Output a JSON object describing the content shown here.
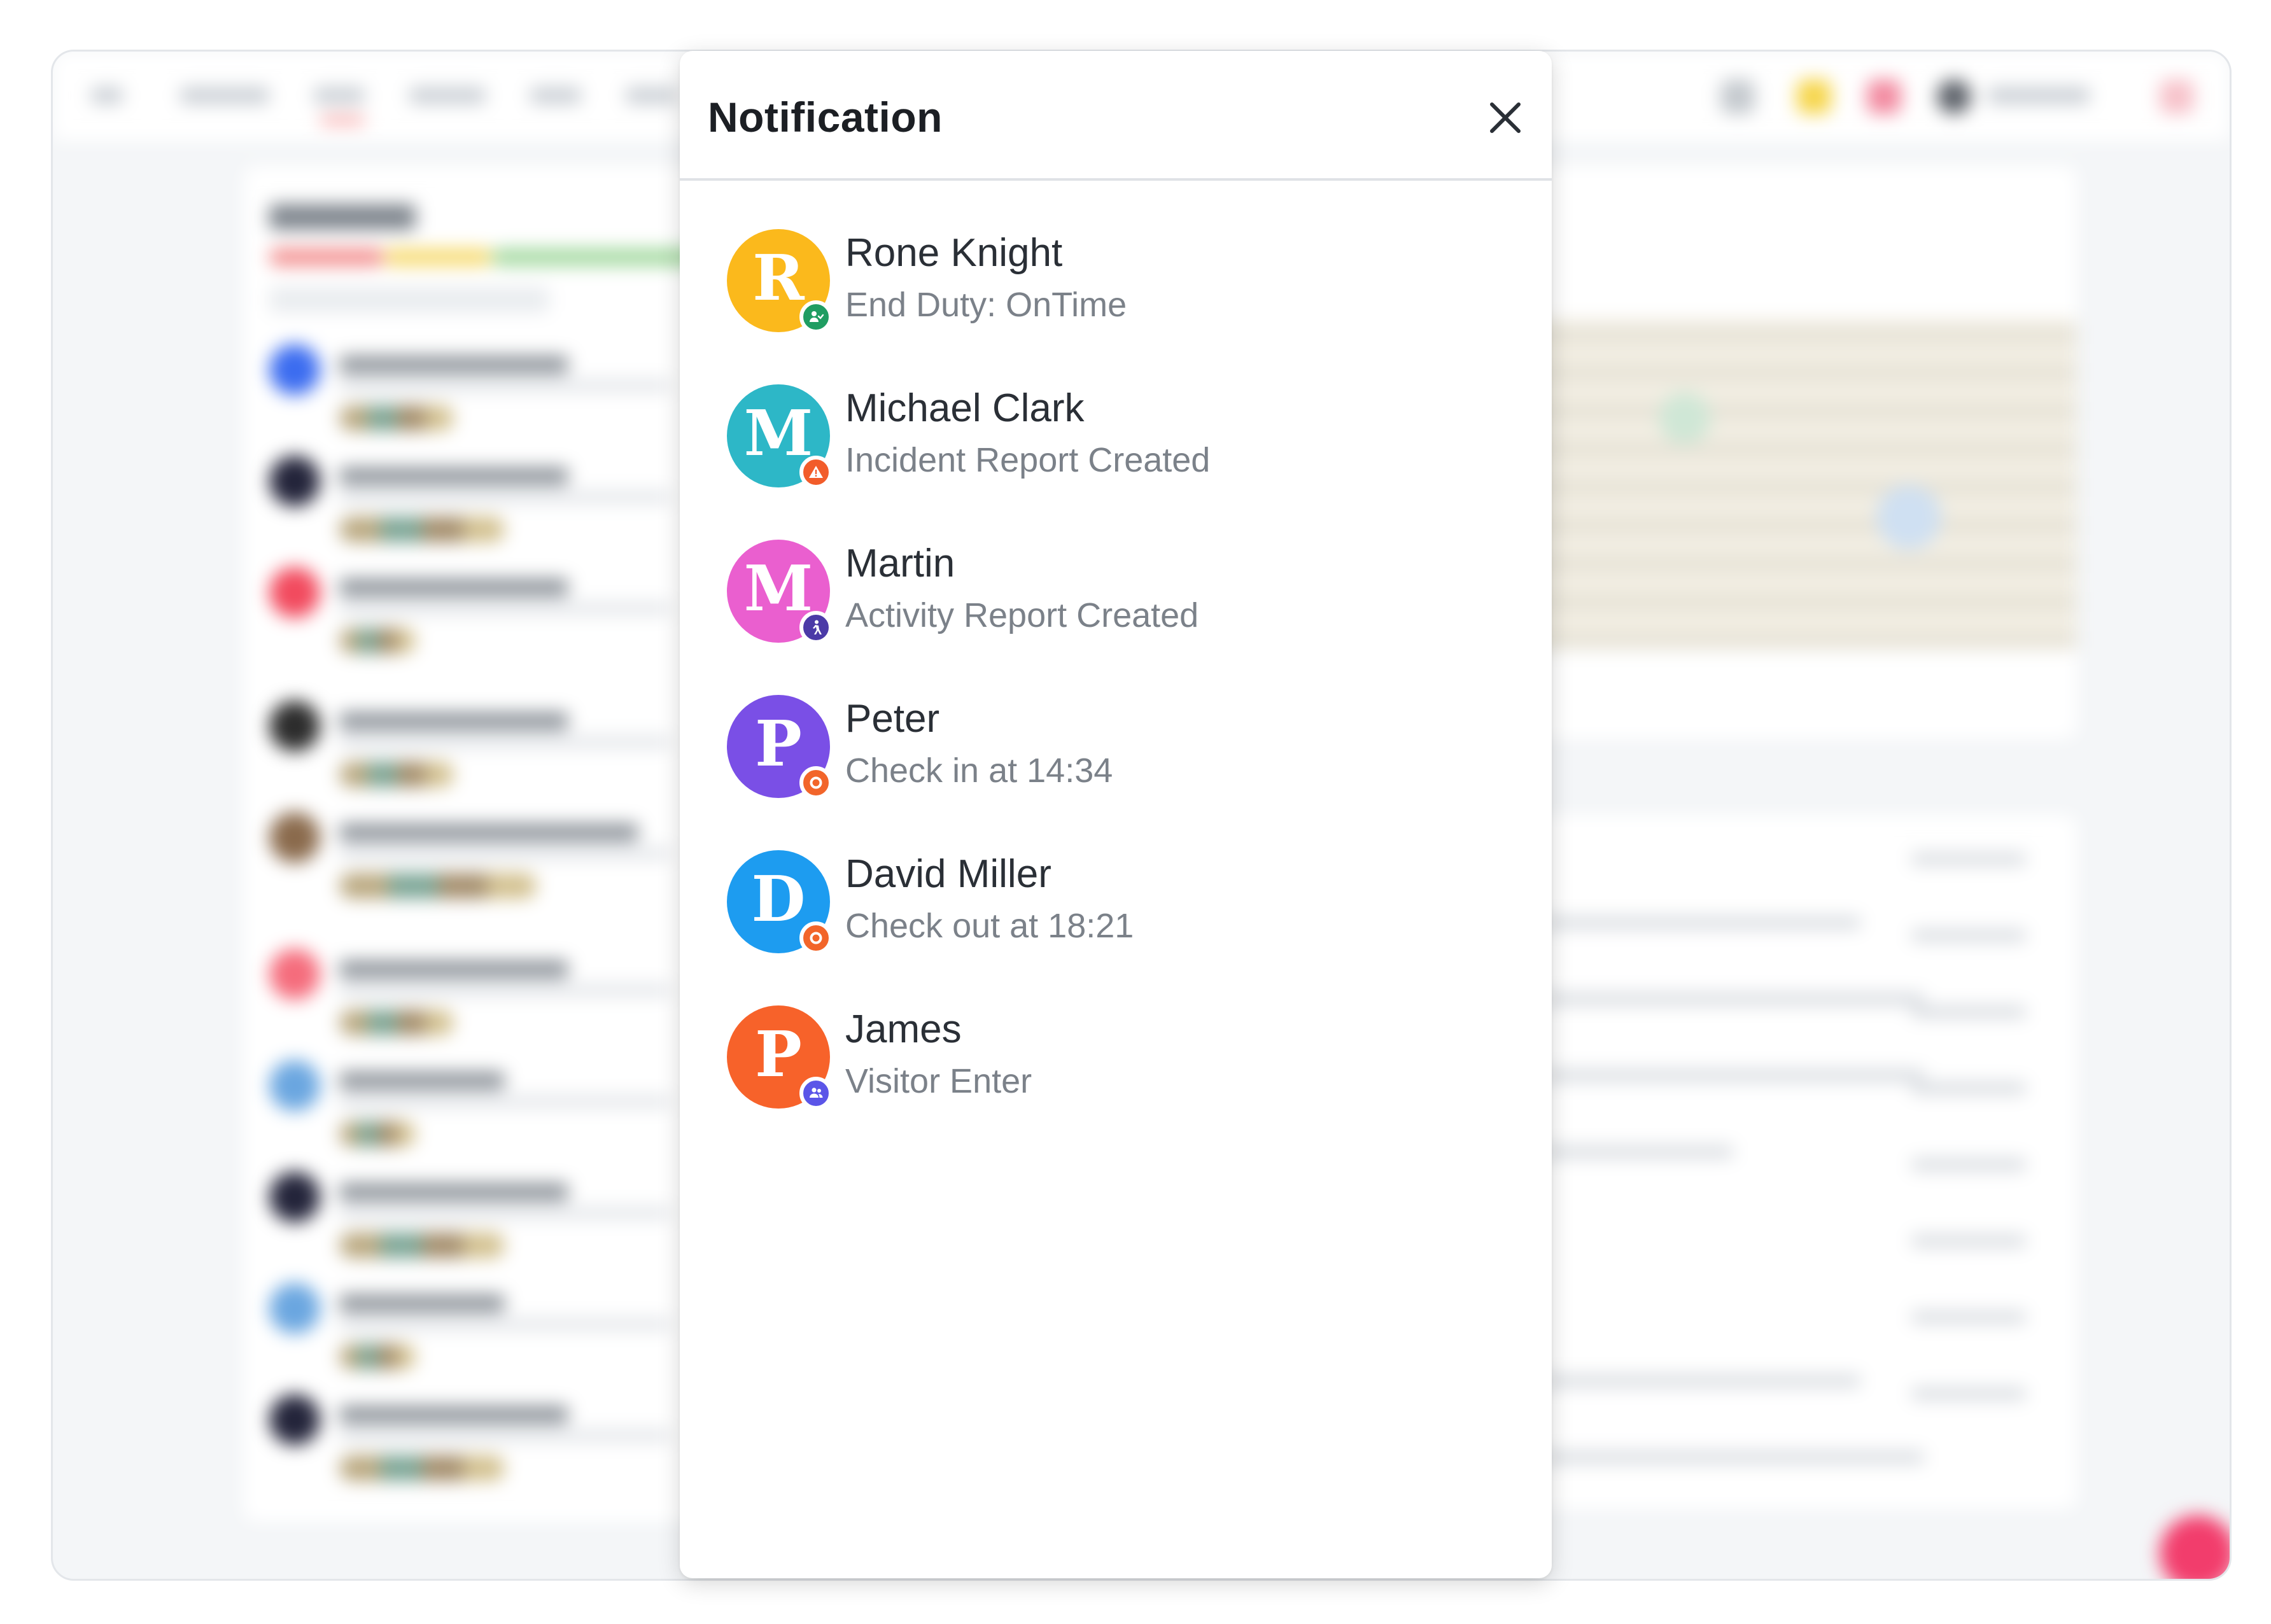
{
  "modal": {
    "title": "Notification",
    "close_icon": "close-icon"
  },
  "notifications": [
    {
      "name": "Rone Knight",
      "description": "End Duty: OnTime",
      "avatar_letter": "R",
      "avatar_color": "#fbb91c",
      "badge_icon": "user-clock-icon",
      "badge_color": "#1f9d62"
    },
    {
      "name": "Michael Clark",
      "description": "Incident Report Created",
      "avatar_letter": "M",
      "avatar_color": "#2db7c7",
      "badge_icon": "warning-icon",
      "badge_color": "#f25c2a"
    },
    {
      "name": "Martin",
      "description": "Activity Report Created",
      "avatar_letter": "M",
      "avatar_color": "#ea5fcf",
      "badge_icon": "person-walk-icon",
      "badge_color": "#4b3aa7"
    },
    {
      "name": "Peter",
      "description": "Check in at 14:34",
      "avatar_letter": "P",
      "avatar_color": "#7a4fe6",
      "badge_icon": "ring-icon",
      "badge_color": "#f2652a"
    },
    {
      "name": "David Miller",
      "description": "Check out at 18:21",
      "avatar_letter": "D",
      "avatar_color": "#1d9cf0",
      "badge_icon": "ring-icon",
      "badge_color": "#f2652a"
    },
    {
      "name": "James",
      "description": "Visitor Enter",
      "avatar_letter": "P",
      "avatar_color": "#f7622a",
      "badge_icon": "visitors-icon",
      "badge_color": "#5b55e8"
    }
  ]
}
